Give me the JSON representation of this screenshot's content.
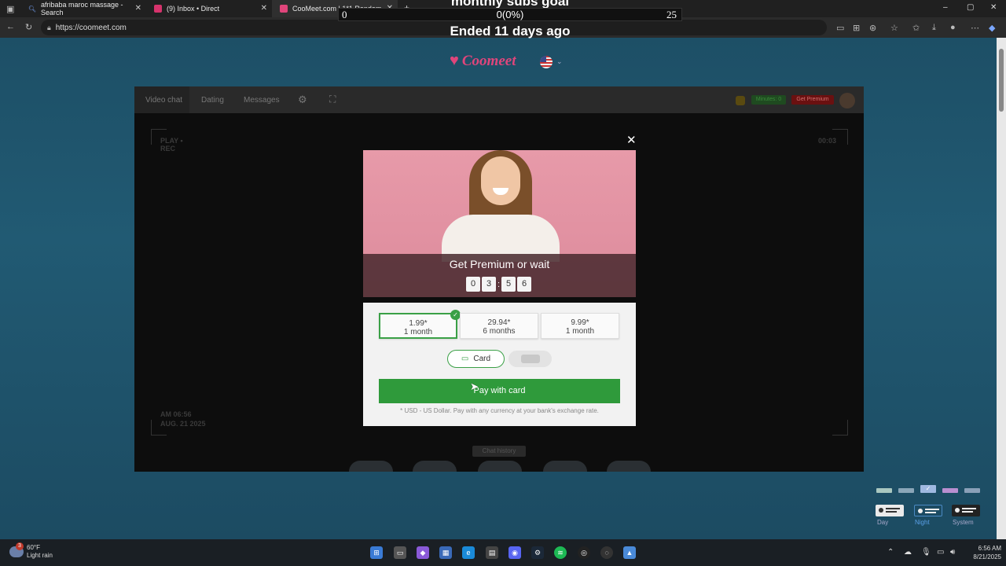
{
  "browser": {
    "tabs": [
      {
        "title": "afribaba maroc massage - Search",
        "icon": "search-icon"
      },
      {
        "title": "(9) Inbox • Direct",
        "icon": "instagram-icon"
      },
      {
        "title": "CooMeet.com | 1*1 Random",
        "icon": "coomeet-icon"
      }
    ],
    "new_tab": "+",
    "url": "https://coomeet.com",
    "window_controls": {
      "minimize": "–",
      "maximize": "▢",
      "close": "✕"
    }
  },
  "overlay": {
    "title": "monthly subs goal",
    "left_value": "0",
    "progress_text": "0(0%)",
    "right_value": "25",
    "progress_fraction": 0.0,
    "subtitle": "Ended 11 days ago"
  },
  "site": {
    "logo_text": "Coomeet",
    "app_nav": {
      "video_chat": "Video chat",
      "dating": "Dating",
      "messages": "Messages",
      "badge_minutes": "Minutes: 0",
      "badge_premium": "Get Premium"
    },
    "video": {
      "play_rec": "PLAY •\nREC",
      "timer": "00:03",
      "timestamp_line1": "AM 06:56",
      "timestamp_line2": "AUG. 21 2025",
      "next_label": "Chat history"
    },
    "modal": {
      "close": "✕",
      "title": "Get Premium or wait",
      "countdown": [
        "0",
        "3",
        "5",
        "6"
      ],
      "plans": [
        {
          "price": "1.99*",
          "period": "1 month",
          "selected": true
        },
        {
          "price": "29.94*",
          "period": "6 months",
          "selected": false
        },
        {
          "price": "9.99*",
          "period": "1 month",
          "selected": false
        }
      ],
      "method_card": "Card",
      "pay_button": "Pay with card",
      "footnote": "* USD - US Dollar. Pay with any currency at your bank's exchange rate."
    },
    "theme": {
      "options": [
        "Day",
        "Night",
        "System"
      ],
      "selected": "Night",
      "swatches": [
        "#a9c7c0",
        "#8aa6b8",
        "#9fb8e0",
        "#b98fd0",
        "#8aa0b8"
      ]
    }
  },
  "taskbar": {
    "weather_temp": "60°F",
    "weather_desc": "Light rain",
    "weather_badge": "3",
    "time": "6:56 AM",
    "date": "8/21/2025"
  }
}
